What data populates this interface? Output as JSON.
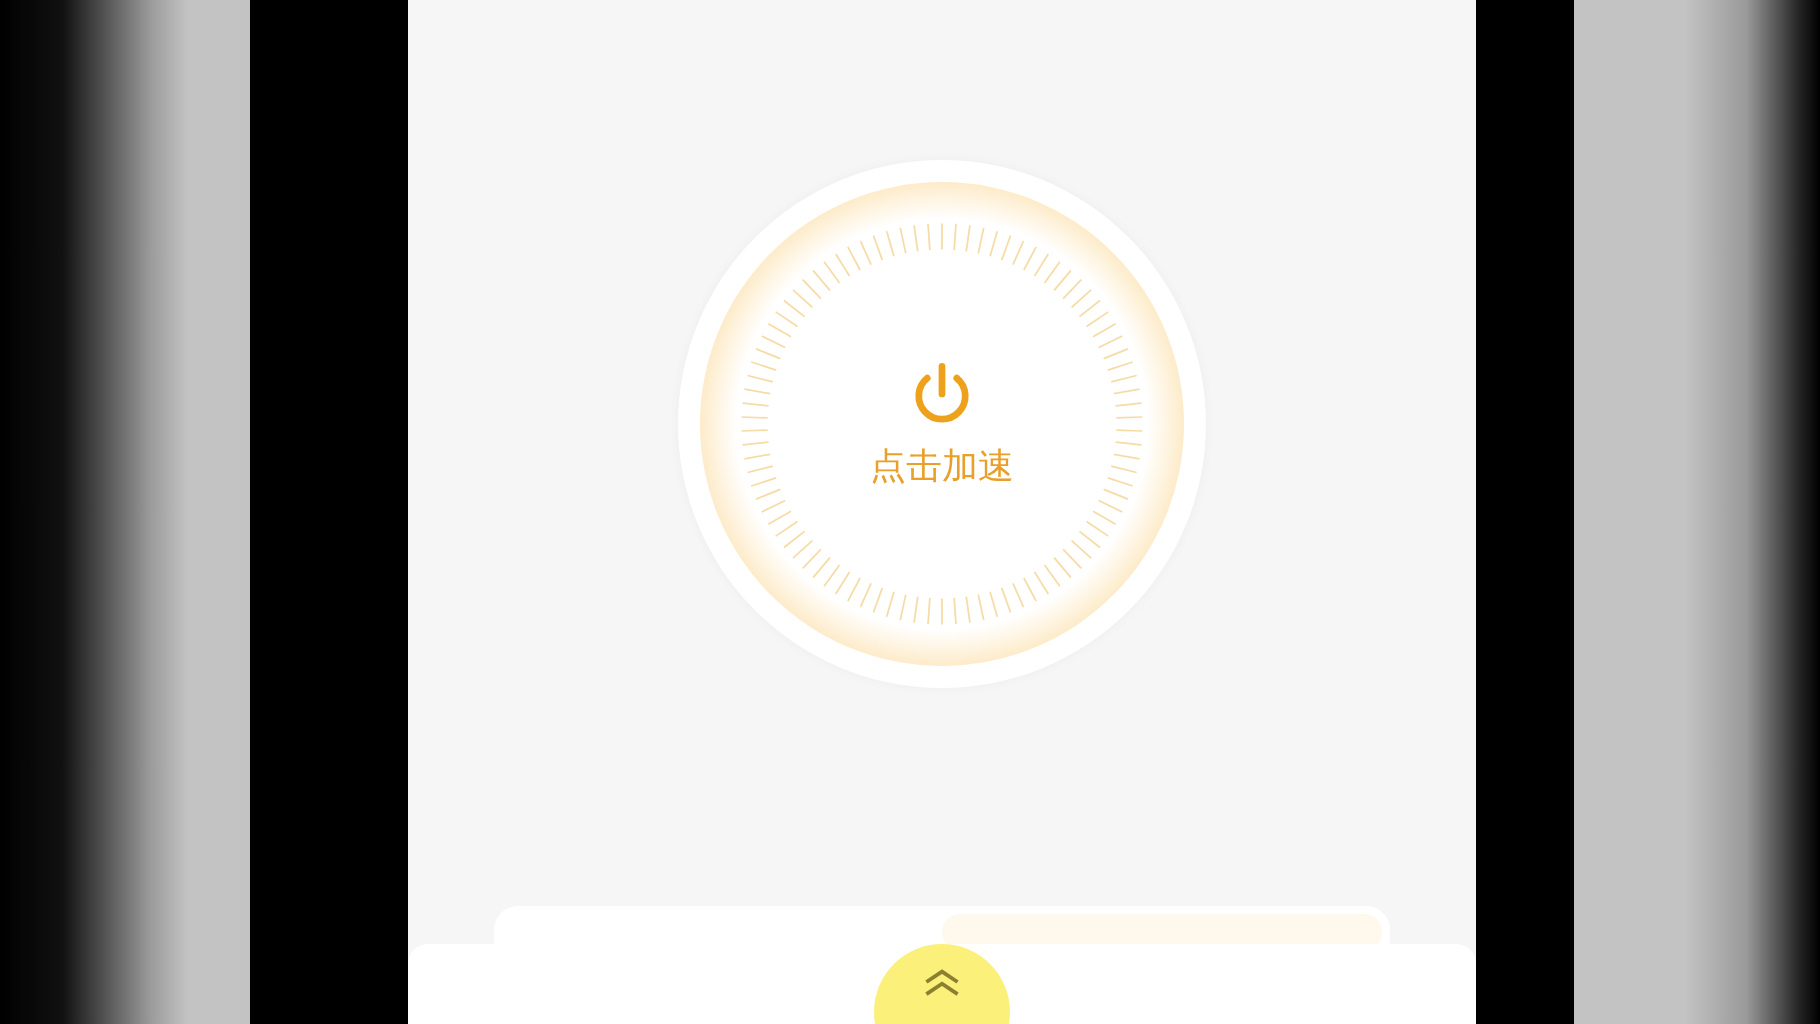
{
  "accelerate_button": {
    "label": "点击加速"
  }
}
